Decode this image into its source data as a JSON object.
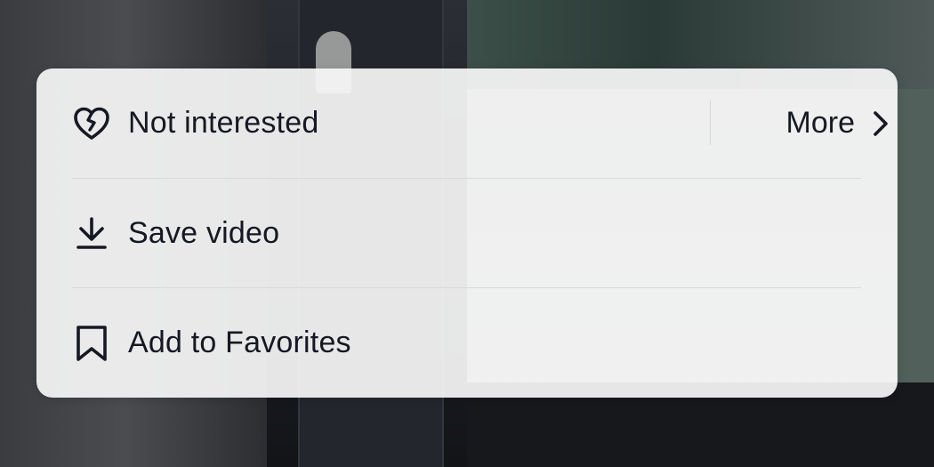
{
  "menu": {
    "items": [
      {
        "label": "Not interested",
        "icon": "broken-heart-icon"
      },
      {
        "label": "Save video",
        "icon": "download-icon"
      },
      {
        "label": "Add to Favorites",
        "icon": "bookmark-icon"
      }
    ],
    "more": {
      "label": "More",
      "icon": "chevron-right-icon"
    }
  },
  "colors": {
    "sheet_background": "#f6f6f6",
    "text": "#161823",
    "divider": "#d9d9d9"
  }
}
